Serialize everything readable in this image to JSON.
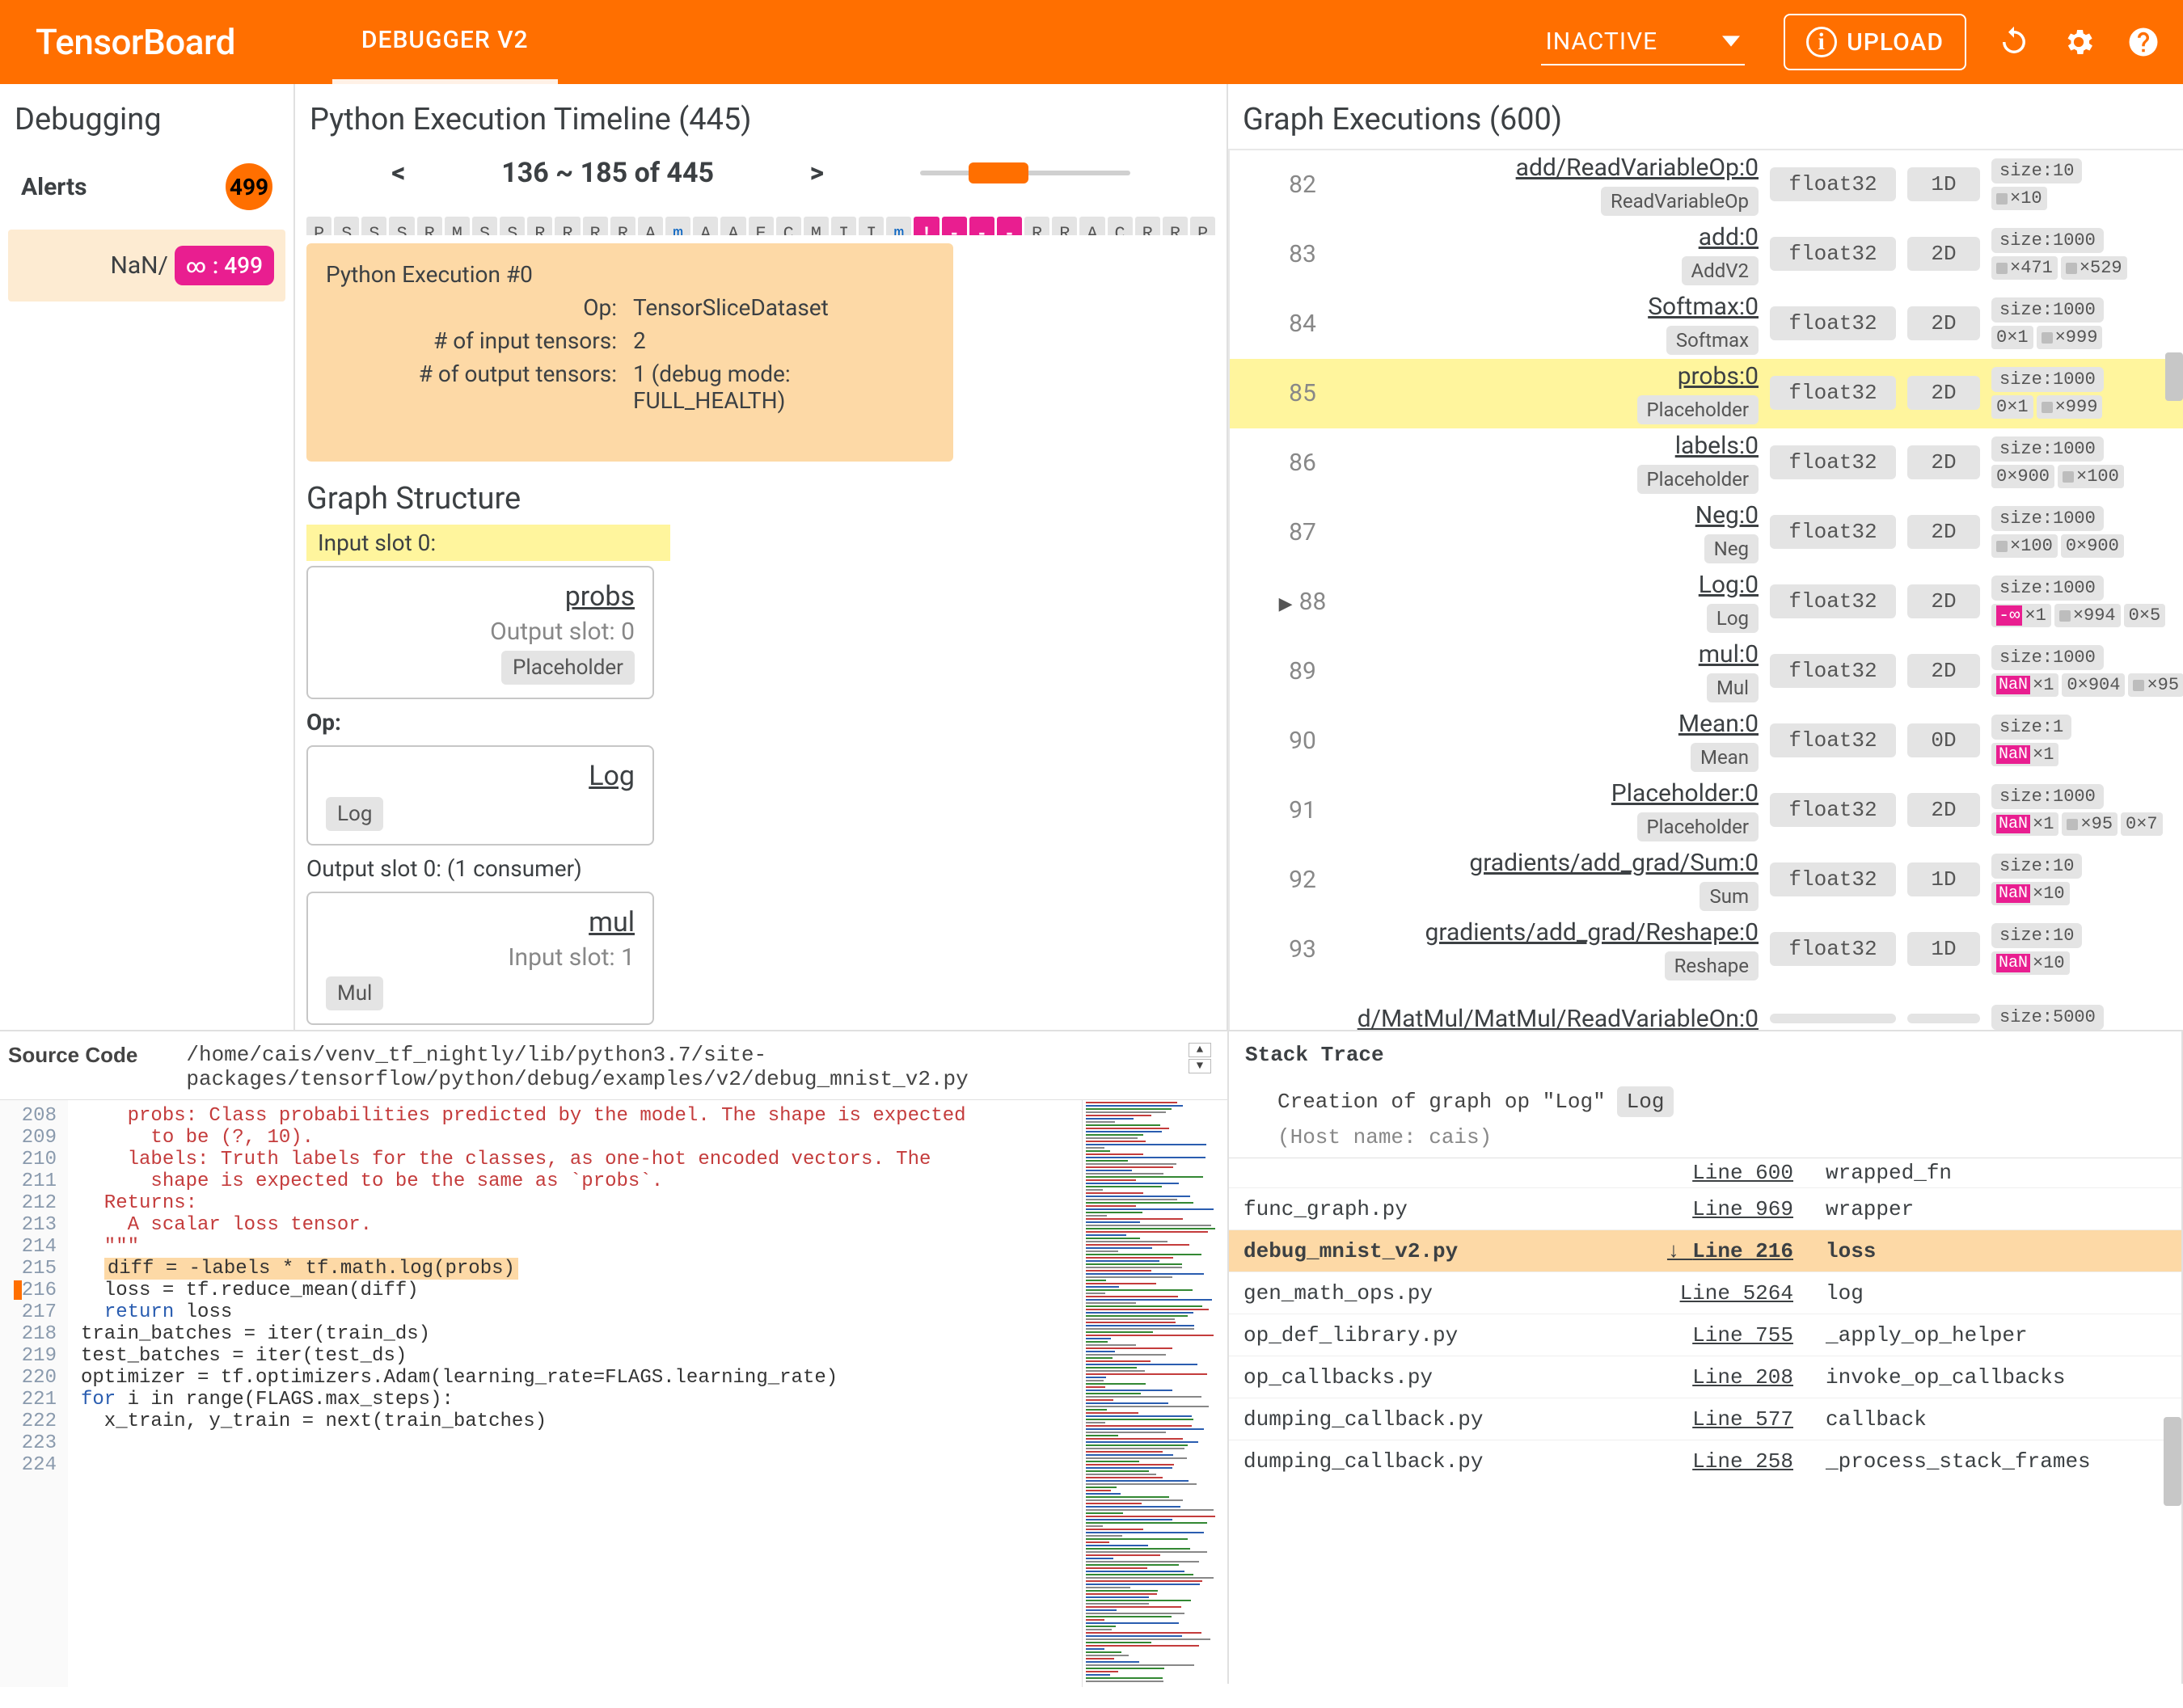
{
  "header": {
    "logo": "TensorBoard",
    "tab": "DEBUGGER V2",
    "status": "INACTIVE",
    "upload": "UPLOAD"
  },
  "alerts": {
    "sidebar_title": "Debugging",
    "title": "Alerts",
    "count": "499",
    "row_label": "NaN/",
    "row_pill_count": ": 499"
  },
  "timeline": {
    "title": "Python Execution Timeline (445)",
    "nav_prev": "<",
    "range": "136 ~ 185 of 445",
    "nav_next": ">",
    "cells": [
      "P",
      "S",
      "S",
      "S",
      "R",
      "M",
      "S",
      "S",
      "R",
      "R",
      "R",
      "R",
      "A",
      "m",
      "A",
      "A",
      "E",
      "C",
      "M",
      "I",
      "I",
      "m",
      "!",
      "-",
      "-",
      "-",
      "R",
      "R",
      "A",
      "C",
      "R",
      "R",
      "P"
    ],
    "cell_link_idx": [
      13,
      21
    ],
    "cell_warn_idx": [
      22,
      23,
      24,
      25
    ],
    "exec": {
      "title": "Python Execution #0",
      "op_k": "Op:",
      "op_v": "TensorSliceDataset",
      "in_k": "# of input tensors:",
      "in_v": "2",
      "out_k": "# of output tensors:",
      "out_v": "1   (debug mode: FULL_HEALTH)"
    },
    "gs_title": "Graph Structure",
    "slot_in": "Input slot 0:",
    "node_in": {
      "name": "probs",
      "slot": "Output slot: 0",
      "tag": "Placeholder"
    },
    "op_label": "Op:",
    "node_op": {
      "name": "Log",
      "tag": "Log"
    },
    "slot_out": "Output slot 0: (1 consumer)",
    "node_out": {
      "name": "mul",
      "slot": "Input slot: 1",
      "tag": "Mul"
    }
  },
  "ge": {
    "title": "Graph Executions (600)",
    "rows": [
      {
        "idx": "82",
        "name": "add/ReadVariableOp:0",
        "op": "ReadVariableOp",
        "dt": "float32",
        "dim": "1D",
        "size": "size:10",
        "parts": [
          {
            "m": "m-gray",
            "t": "×10"
          }
        ]
      },
      {
        "idx": "83",
        "name": "add:0",
        "op": "AddV2",
        "dt": "float32",
        "dim": "2D",
        "size": "size:1000",
        "parts": [
          {
            "m": "m-gray",
            "t": "×471"
          },
          {
            "m": "m-gray",
            "t": "×529"
          }
        ]
      },
      {
        "idx": "84",
        "name": "Softmax:0",
        "op": "Softmax",
        "dt": "float32",
        "dim": "2D",
        "size": "size:1000",
        "parts": [
          {
            "m": "",
            "t": "0×1"
          },
          {
            "m": "m-gray",
            "t": "×999"
          }
        ]
      },
      {
        "idx": "85",
        "sel": true,
        "name": "probs:0",
        "op": "Placeholder",
        "dt": "float32",
        "dim": "2D",
        "size": "size:1000",
        "parts": [
          {
            "m": "",
            "t": "0×1"
          },
          {
            "m": "m-gray",
            "t": "×999"
          }
        ]
      },
      {
        "idx": "86",
        "name": "labels:0",
        "op": "Placeholder",
        "dt": "float32",
        "dim": "2D",
        "size": "size:1000",
        "parts": [
          {
            "m": "",
            "t": "0×900"
          },
          {
            "m": "m-gray",
            "t": "×100"
          }
        ]
      },
      {
        "idx": "87",
        "name": "Neg:0",
        "op": "Neg",
        "dt": "float32",
        "dim": "2D",
        "size": "size:1000",
        "parts": [
          {
            "m": "m-gray",
            "t": "×100"
          },
          {
            "m": "",
            "t": "0×900"
          }
        ]
      },
      {
        "idx": "88",
        "arrow": true,
        "name": "Log:0",
        "op": "Log",
        "dt": "float32",
        "dim": "2D",
        "size": "size:1000",
        "parts": [
          {
            "m": "m-red",
            "t": "-∞×1"
          },
          {
            "m": "m-gray",
            "t": "×994"
          },
          {
            "m": "",
            "t": "0×5"
          }
        ]
      },
      {
        "idx": "89",
        "name": "mul:0",
        "op": "Mul",
        "dt": "float32",
        "dim": "2D",
        "size": "size:1000",
        "parts": [
          {
            "m": "m-nan",
            "t": "NaN×1"
          },
          {
            "m": "",
            "t": "0×904"
          },
          {
            "m": "m-gray",
            "t": "×95"
          }
        ]
      },
      {
        "idx": "90",
        "name": "Mean:0",
        "op": "Mean",
        "dt": "float32",
        "dim": "0D",
        "size": "size:1",
        "parts": [
          {
            "m": "m-nan",
            "t": "NaN×1"
          }
        ]
      },
      {
        "idx": "91",
        "name": "Placeholder:0",
        "op": "Placeholder",
        "dt": "float32",
        "dim": "2D",
        "size": "size:1000",
        "parts": [
          {
            "m": "m-nan",
            "t": "NaN×1"
          },
          {
            "m": "m-gray",
            "t": "×95"
          },
          {
            "m": "",
            "t": "0×7"
          }
        ]
      },
      {
        "idx": "92",
        "name": "gradients/add_grad/Sum:0",
        "op": "Sum",
        "dt": "float32",
        "dim": "1D",
        "size": "size:10",
        "parts": [
          {
            "m": "m-nan",
            "t": "NaN×10"
          }
        ]
      },
      {
        "idx": "93",
        "name": "gradients/add_grad/Reshape:0",
        "op": "Reshape",
        "dt": "float32",
        "dim": "1D",
        "size": "size:10",
        "parts": [
          {
            "m": "m-nan",
            "t": "NaN×10"
          }
        ]
      },
      {
        "idx": "",
        "name": "d/MatMul/MatMul/ReadVariableOn:0",
        "op": "",
        "dt": "",
        "dim": "",
        "size": "size:5000",
        "parts": []
      }
    ]
  },
  "src": {
    "head_label": "Source Code",
    "path": "/home/cais/venv_tf_nightly/lib/python3.7/site-\npackages/tensorflow/python/debug/examples/v2/debug_mnist_v2.py",
    "lines": [
      {
        "n": "208",
        "t": "    probs: Class probabilities predicted by the model. The shape is expected",
        "cls": "s-red"
      },
      {
        "n": "209",
        "t": "      to be (?, 10).",
        "cls": "s-red"
      },
      {
        "n": "210",
        "t": "    labels: Truth labels for the classes, as one-hot encoded vectors. The",
        "cls": "s-red"
      },
      {
        "n": "211",
        "t": "      shape is expected to be the same as `probs`.",
        "cls": "s-red"
      },
      {
        "n": "212",
        "t": ""
      },
      {
        "n": "213",
        "t": "  Returns:",
        "cls": "s-red"
      },
      {
        "n": "214",
        "t": "    A scalar loss tensor.",
        "cls": "s-red"
      },
      {
        "n": "215",
        "t": "  \"\"\"",
        "cls": "s-red"
      },
      {
        "n": "216",
        "hl": true,
        "t": "  diff = -labels * tf.math.log(probs)"
      },
      {
        "n": "217",
        "t": "  loss = tf.reduce_mean(diff)"
      },
      {
        "n": "218",
        "t": "  return loss",
        "cls": "s-blue",
        "kw": "return"
      },
      {
        "n": "219",
        "t": ""
      },
      {
        "n": "220",
        "t": "train_batches = iter(train_ds)"
      },
      {
        "n": "221",
        "t": "test_batches = iter(test_ds)"
      },
      {
        "n": "222",
        "t": "optimizer = tf.optimizers.Adam(learning_rate=FLAGS.learning_rate)"
      },
      {
        "n": "223",
        "t": "for i in range(FLAGS.max_steps):",
        "cls": "s-blue",
        "kw": "for"
      },
      {
        "n": "224",
        "t": "  x_train, y_train = next(train_batches)"
      }
    ]
  },
  "stack": {
    "head": "Stack Trace",
    "sub_text": "Creation of graph op \"Log\"",
    "sub_tag": "Log",
    "host": "(Host name: cais)",
    "rows": [
      {
        "f": "",
        "ln": "Line 600",
        "fn": "wrapped_fn",
        "first": true
      },
      {
        "f": "func_graph.py",
        "ln": "Line 969",
        "fn": "wrapper"
      },
      {
        "f": "debug_mnist_v2.py",
        "ln": "Line 216",
        "fn": "loss",
        "hl": true
      },
      {
        "f": "gen_math_ops.py",
        "ln": "Line 5264",
        "fn": "log"
      },
      {
        "f": "op_def_library.py",
        "ln": "Line 755",
        "fn": "_apply_op_helper"
      },
      {
        "f": "op_callbacks.py",
        "ln": "Line 208",
        "fn": "invoke_op_callbacks"
      },
      {
        "f": "dumping_callback.py",
        "ln": "Line 577",
        "fn": "callback"
      },
      {
        "f": "dumping_callback.py",
        "ln": "Line 258",
        "fn": "_process_stack_frames"
      }
    ]
  }
}
